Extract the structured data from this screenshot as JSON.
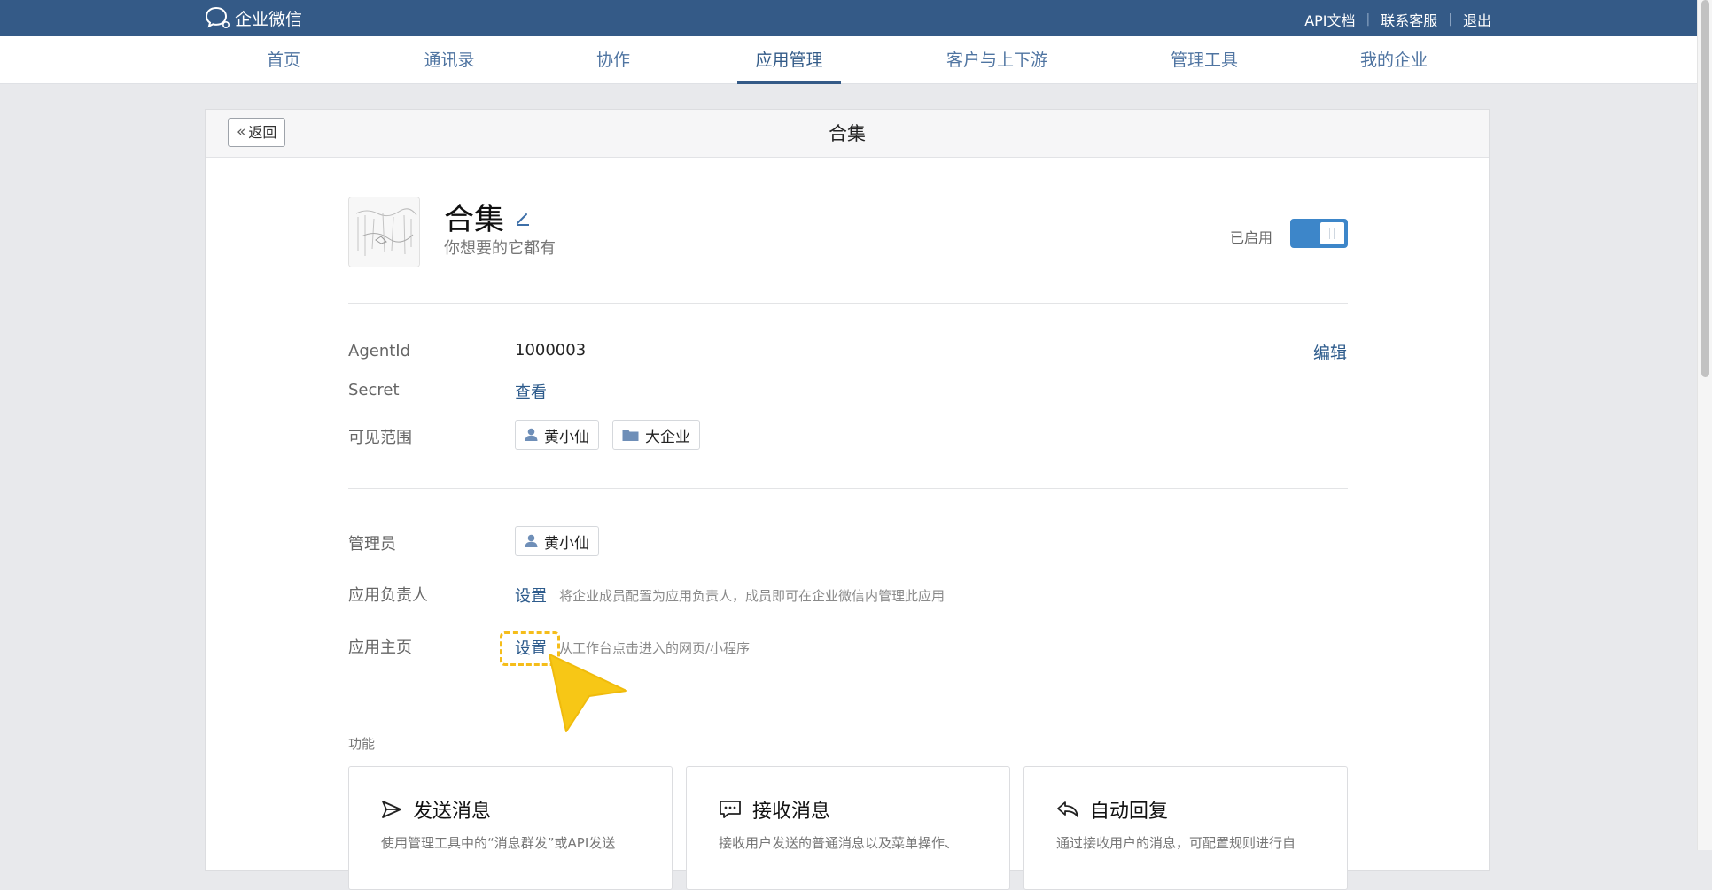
{
  "topbar": {
    "logo_text": "企业微信",
    "links": [
      "API文档",
      "联系客服",
      "退出"
    ]
  },
  "nav": {
    "items": [
      "首页",
      "通讯录",
      "协作",
      "应用管理",
      "客户与上下游",
      "管理工具",
      "我的企业"
    ],
    "active": "应用管理"
  },
  "card": {
    "back_label": "返回",
    "title": "合集"
  },
  "app": {
    "name": "合集",
    "description": "你想要的它都有",
    "status_label": "已启用",
    "enabled": true
  },
  "info": {
    "agentid_label": "AgentId",
    "agentid_value": "1000003",
    "edit_label": "编辑",
    "secret_label": "Secret",
    "secret_action": "查看",
    "visible_label": "可见范围",
    "visible_tags": [
      {
        "icon": "user-icon",
        "text": "黄小仙"
      },
      {
        "icon": "folder-icon",
        "text": "大企业"
      }
    ]
  },
  "admin": {
    "admin_label": "管理员",
    "admin_tag": "黄小仙",
    "owner_label": "应用负责人",
    "owner_action": "设置",
    "owner_hint": "将企业成员配置为应用负责人，成员即可在企业微信内管理此应用",
    "homepage_label": "应用主页",
    "homepage_action": "设置",
    "homepage_hint": "从工作台点击进入的网页/小程序"
  },
  "features": {
    "section_label": "功能",
    "cards": [
      {
        "icon": "send-icon",
        "title": "发送消息",
        "desc": "使用管理工具中的“消息群发”或API发送"
      },
      {
        "icon": "chat-icon",
        "title": "接收消息",
        "desc": "接收用户发送的普通消息以及菜单操作、"
      },
      {
        "icon": "reply-icon",
        "title": "自动回复",
        "desc": "通过接收用户的消息，可配置规则进行自"
      }
    ]
  },
  "colors": {
    "brand": "#345a87",
    "link": "#2d5b8c",
    "toggle_on": "#3d86c9",
    "highlight": "#f5bd1a"
  }
}
